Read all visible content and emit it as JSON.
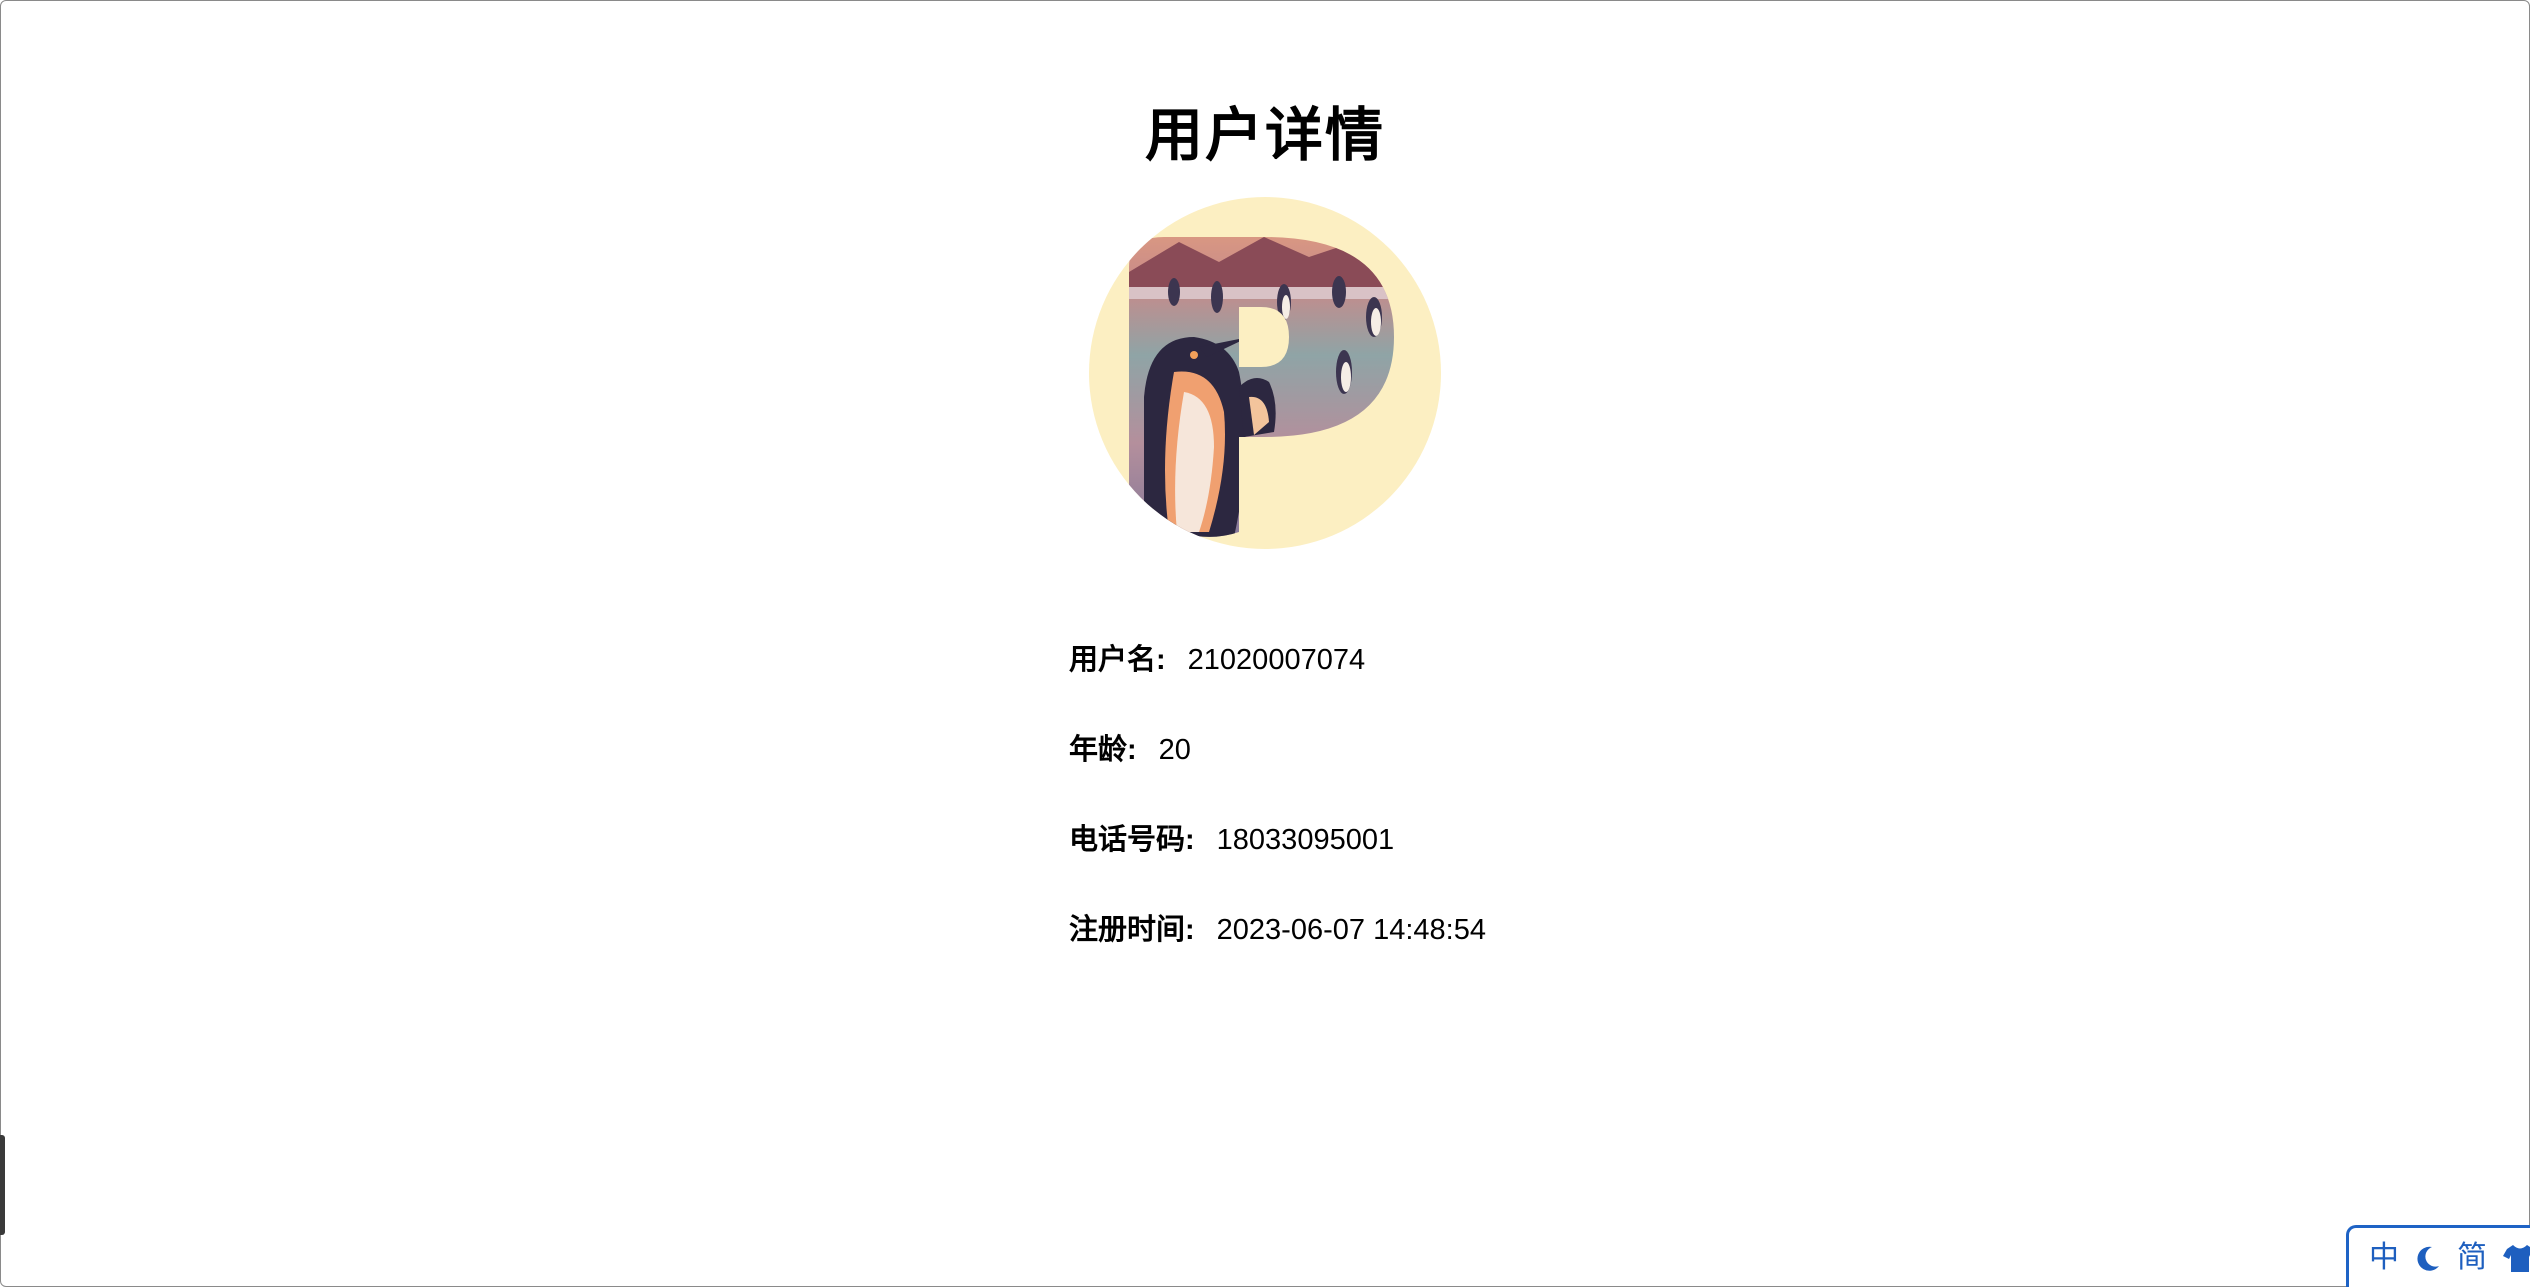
{
  "page": {
    "title": "用户详情"
  },
  "user": {
    "avatar_icon": "penguin-letter-p-avatar",
    "fields": [
      {
        "label": "用户名:",
        "value": "21020007074"
      },
      {
        "label": "年龄:",
        "value": "20"
      },
      {
        "label": "电话号码:",
        "value": "18033095001"
      },
      {
        "label": "注册时间:",
        "value": "2023-06-07 14:48:54"
      }
    ]
  },
  "ime_toolbar": {
    "lang_label": "中",
    "mode_icon": "moon-icon",
    "charset_label": "简",
    "skin_icon": "shirt-icon",
    "color": "#1e5fbf"
  }
}
